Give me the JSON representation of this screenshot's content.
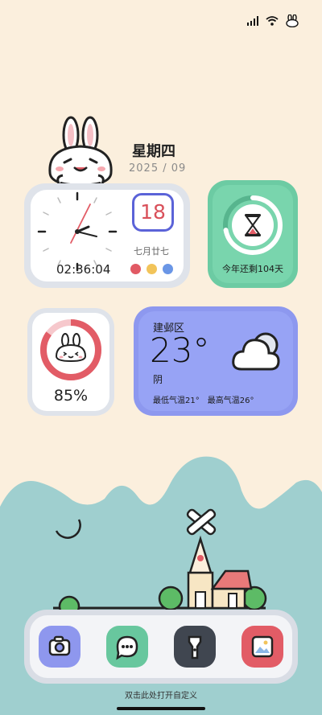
{
  "header": {
    "weekday": "星期四",
    "date": "2025 / 09"
  },
  "clock_widget": {
    "time": "02:36:04",
    "day": "18",
    "lunar": "七月廿七",
    "dot_colors": [
      "#e15a64",
      "#f2c45a",
      "#6a96e6"
    ]
  },
  "year_widget": {
    "text": "今年还剩104天",
    "progress": 0.72
  },
  "battery_widget": {
    "percent_label": "85%",
    "percent": 85
  },
  "weather_widget": {
    "city": "建邺区",
    "temperature": "23°",
    "condition": "阴",
    "low": "最低气温21°",
    "high": "最高气温26°"
  },
  "dock": {
    "apps": [
      {
        "name": "camera",
        "icon": "camera-icon",
        "color": "#8e97ee"
      },
      {
        "name": "messages",
        "icon": "chat-bubble-icon",
        "color": "#68c79e"
      },
      {
        "name": "flashlight",
        "icon": "flashlight-icon",
        "color": "#404650"
      },
      {
        "name": "gallery",
        "icon": "gallery-icon",
        "color": "#e25c66"
      }
    ]
  },
  "hint": "双击此处打开自定义",
  "colors": {
    "background": "#fbefdd",
    "hills": "#9fcfcf",
    "accent_red": "#e25c66"
  }
}
